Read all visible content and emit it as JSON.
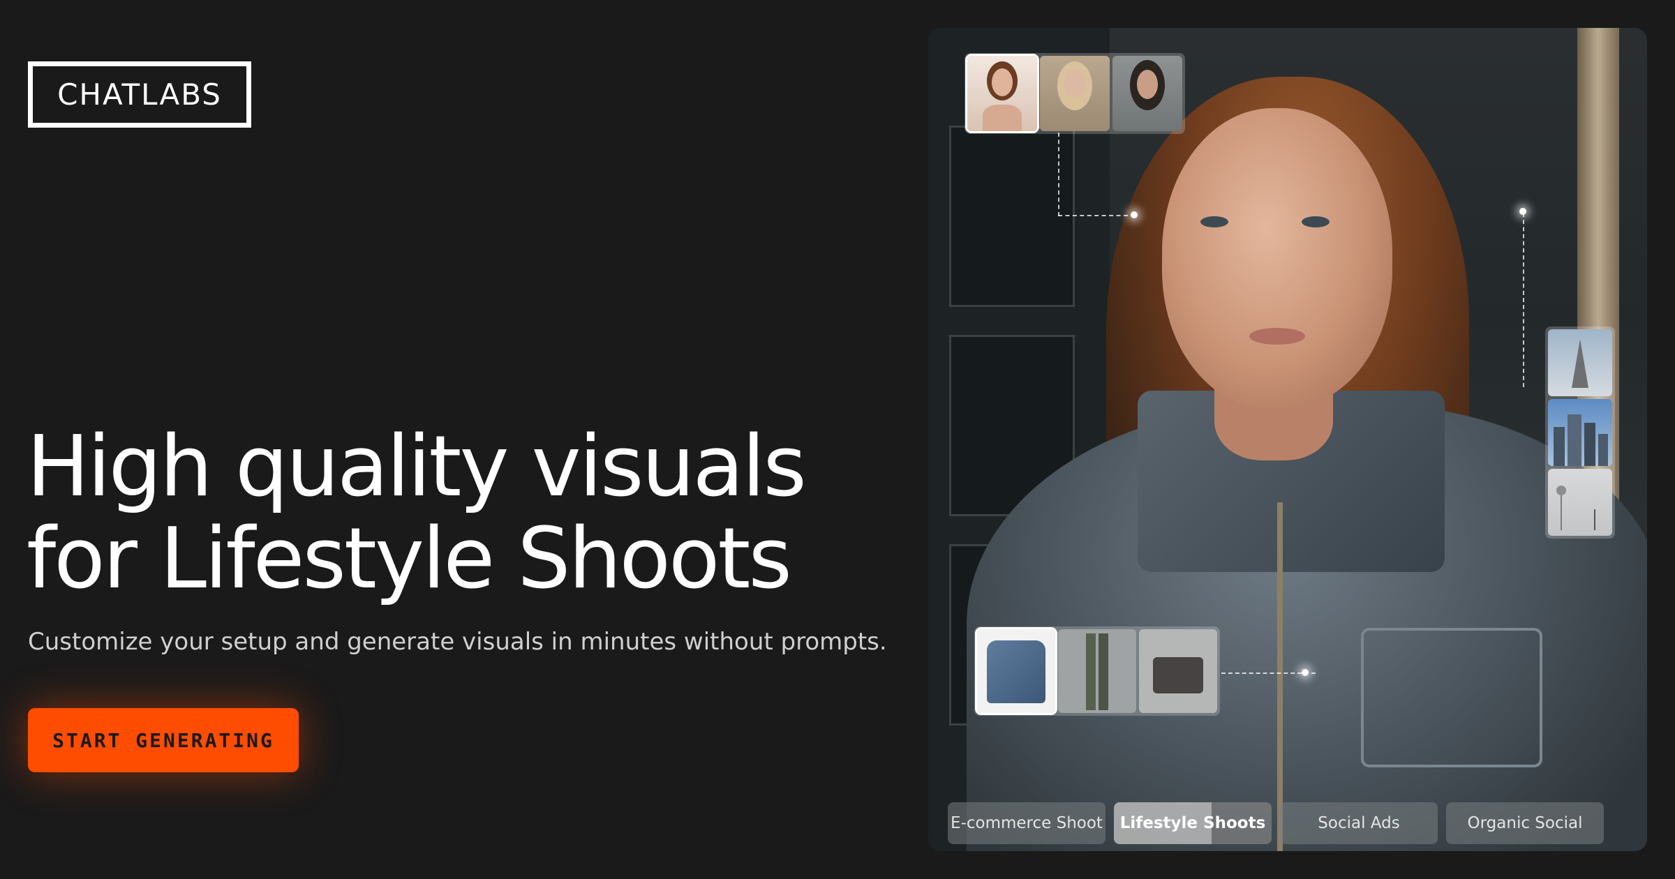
{
  "brand": {
    "logo_text": "CHATLABS"
  },
  "hero": {
    "headline_line1": "High quality visuals",
    "headline_line2": "for Lifestyle Shoots",
    "subheadline": "Customize your setup and generate visuals in minutes without prompts.",
    "cta_label": "START GENERATING"
  },
  "colors": {
    "background": "#1a1a1a",
    "accent": "#ff4d00",
    "text": "#ffffff"
  },
  "visual_panel": {
    "model_thumbnails": [
      {
        "icon": "model-portrait-1",
        "selected": true
      },
      {
        "icon": "model-portrait-2",
        "selected": false
      },
      {
        "icon": "model-portrait-3",
        "selected": false
      }
    ],
    "location_thumbnails": [
      {
        "icon": "eiffel-tower-scene",
        "selected": false
      },
      {
        "icon": "city-skyline-scene",
        "selected": false
      },
      {
        "icon": "studio-lights-scene",
        "selected": false
      }
    ],
    "garment_thumbnails": [
      {
        "icon": "denim-jacket",
        "selected": true
      },
      {
        "icon": "green-trousers",
        "selected": false
      },
      {
        "icon": "grey-skirt",
        "selected": false
      }
    ],
    "tabs": [
      {
        "label": "E-commerce Shoot",
        "active": false
      },
      {
        "label": "Lifestyle Shoots",
        "active": true
      },
      {
        "label": "Social Ads",
        "active": false
      },
      {
        "label": "Organic Social",
        "active": false
      }
    ]
  }
}
